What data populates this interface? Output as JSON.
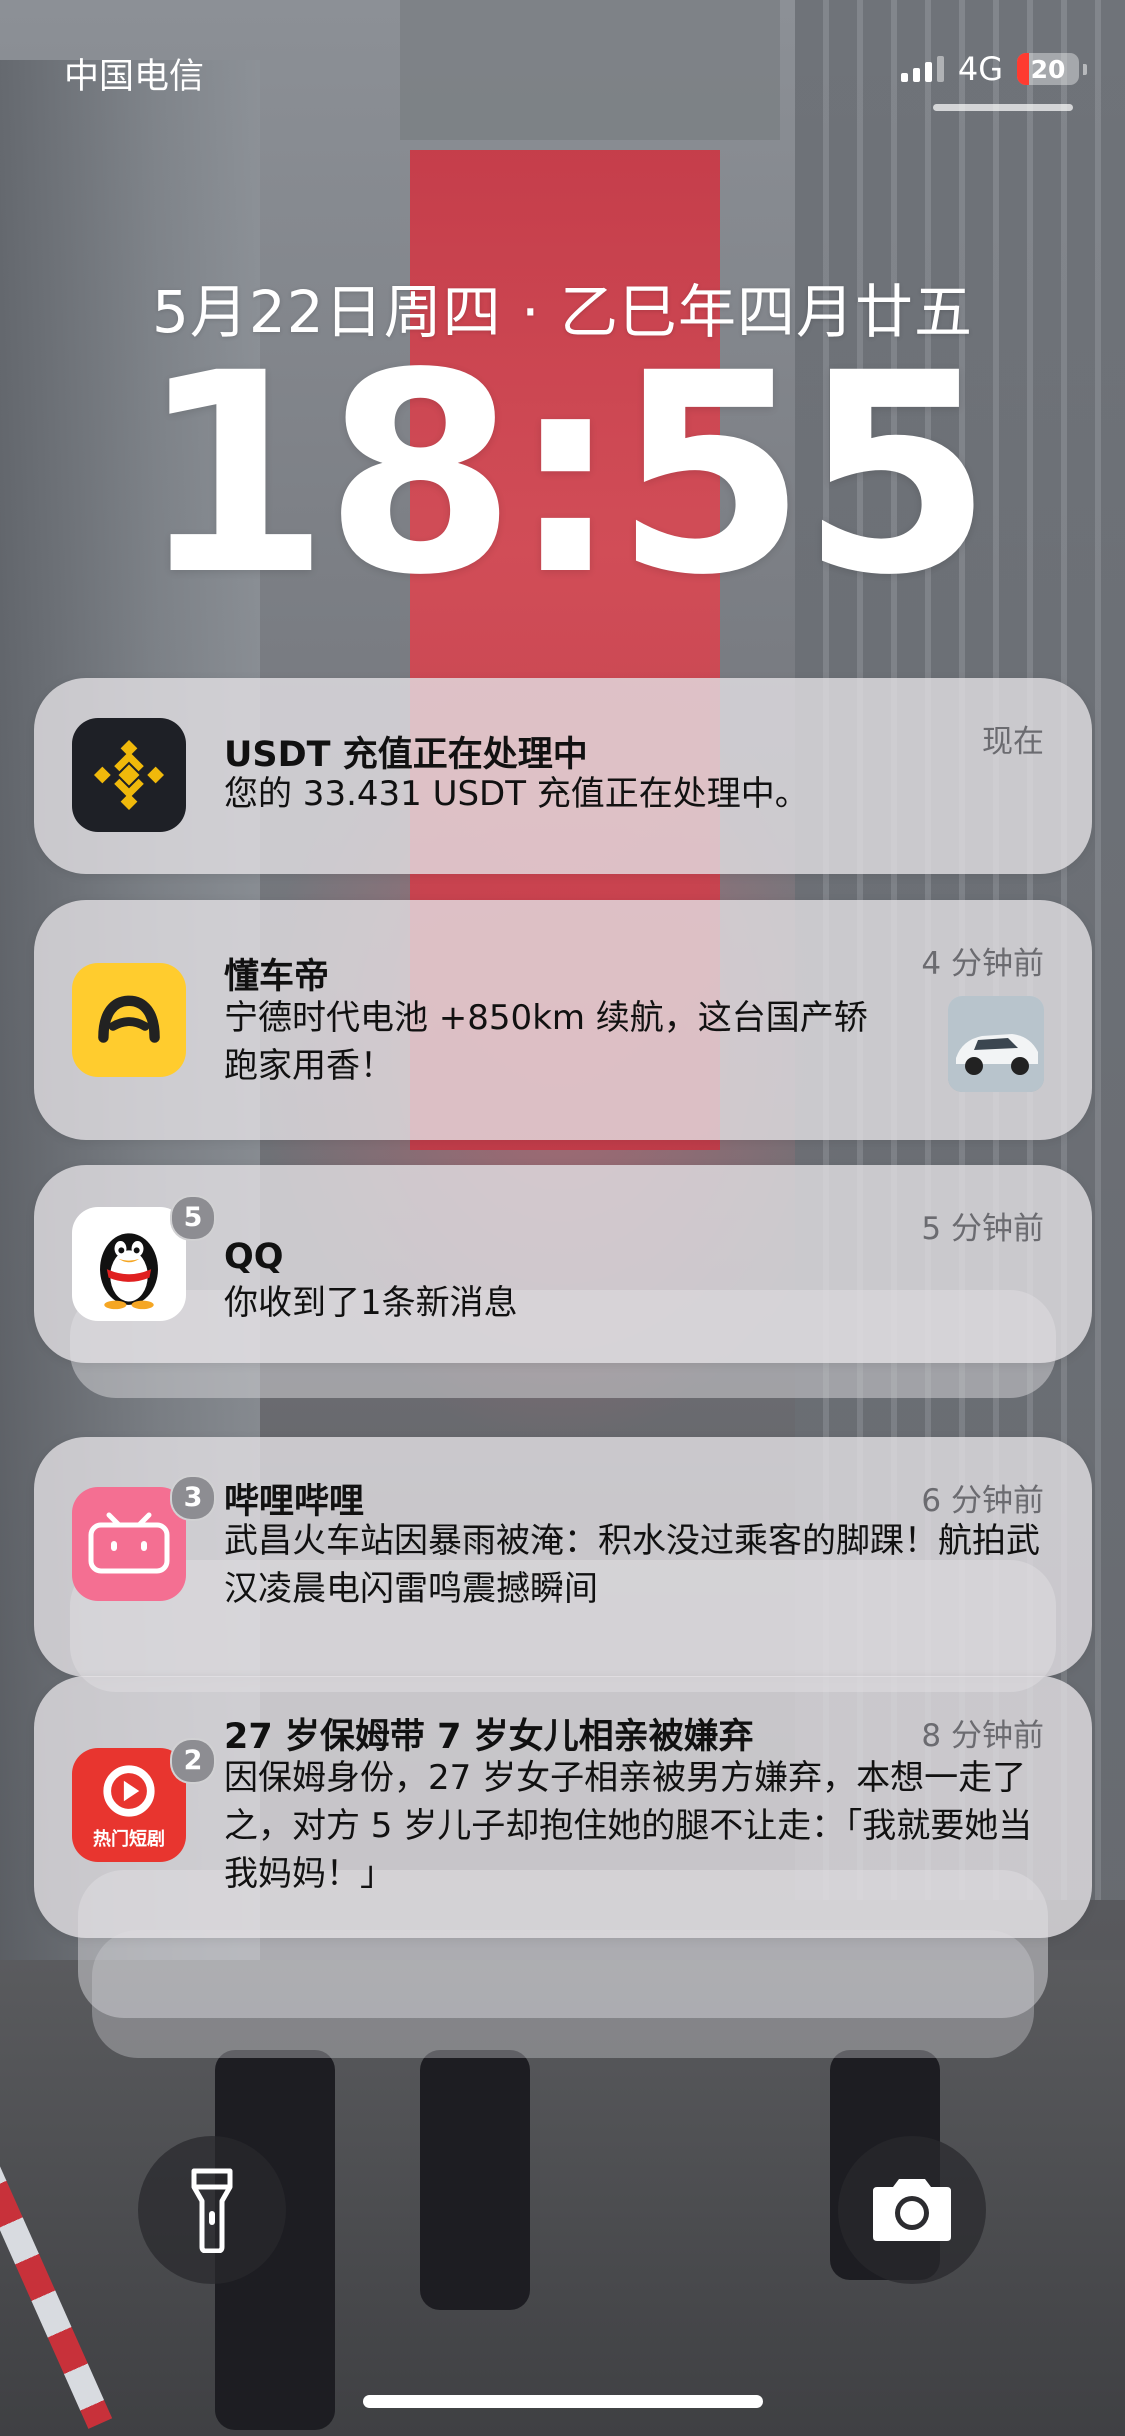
{
  "status_bar": {
    "carrier": "中国电信",
    "network": "4G",
    "battery_level": "20",
    "battery_fraction": 0.2
  },
  "lock_screen": {
    "date": "5月22日周四 · 乙巳年四月廿五",
    "time": "18:55"
  },
  "notifications": [
    {
      "app": "Binance",
      "icon": "binance-icon",
      "title": "USDT 充值正在处理中",
      "body": "您的 33.431 USDT 充值正在处理中。",
      "time": "现在"
    },
    {
      "app": "懂车帝",
      "icon": "dongchedi-icon",
      "title": "懂车帝",
      "body": "宁德时代电池 +850km 续航，这台国产轿跑家用香！",
      "time": "4 分钟前",
      "has_thumbnail": true
    },
    {
      "app": "QQ",
      "icon": "qq-penguin-icon",
      "title": "QQ",
      "body": "你收到了1条新消息",
      "time": "5 分钟前",
      "badge": "5"
    },
    {
      "app": "哔哩哔哩",
      "icon": "bilibili-icon",
      "title": "哔哩哔哩",
      "body": "武昌火车站因暴雨被淹：积水没过乘客的脚踝！航拍武汉凌晨电闪雷鸣震撼瞬间",
      "time": "6 分钟前",
      "badge": "3"
    },
    {
      "app": "热门短剧",
      "icon": "short-drama-icon",
      "icon_caption": "热门短剧",
      "title": "27 岁保姆带 7 岁女儿相亲被嫌弃",
      "body": "因保姆身份，27 岁女子相亲被男方嫌弃，本想一走了之，对方 5 岁儿子却抱住她的腿不让走：「我就要她当我妈妈！」",
      "time": "8 分钟前",
      "badge": "2"
    }
  ],
  "controls": {
    "flashlight": "flashlight-icon",
    "camera": "camera-icon"
  },
  "colors": {
    "binance_bg": "#1e2026",
    "binance_yellow": "#f0b90b",
    "dongchedi_yellow": "#ffcc2e",
    "bilibili_pink": "#f46f92",
    "drama_red": "#e8352f",
    "battery_red": "#ff3b30"
  }
}
